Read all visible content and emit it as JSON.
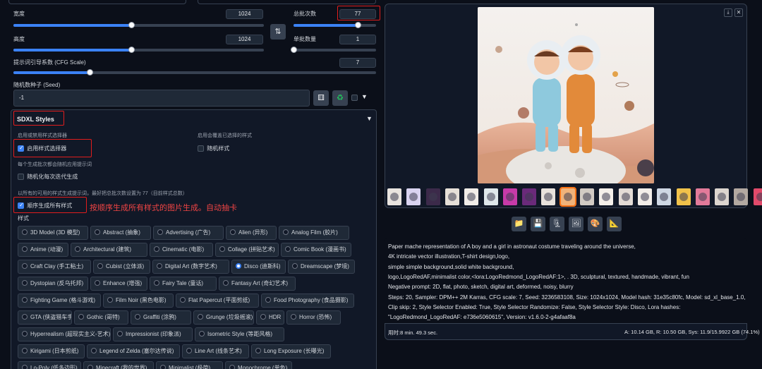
{
  "left": {
    "width": {
      "label": "宽度",
      "value": "1024",
      "fraction": 0.47
    },
    "height": {
      "label": "高度",
      "value": "1024",
      "fraction": 0.47
    },
    "swap_icon": "swap-arrows-icon",
    "batch_count": {
      "label": "总批次数",
      "value": "77",
      "fraction": 0.78
    },
    "batch_size": {
      "label": "单批数量",
      "value": "1",
      "fraction": 0.0
    },
    "cfg": {
      "label": "提示词引导系数 (CFG Scale)",
      "value": "7",
      "fraction": 0.21
    },
    "seed": {
      "label": "随机数种子 (Seed)",
      "value": "-1"
    },
    "seed_icons": [
      "dice-icon",
      "recycle-icon"
    ]
  },
  "sdxl": {
    "title": "SDXL Styles",
    "enable_hint": "启用或禁用样式选择器",
    "enable_label": "启用样式选择器",
    "random_hint": "启用会覆盖已选择的样式",
    "random_label": "随机样式",
    "each_batch_hint": "每个生成批次都会随机应用提示词",
    "randomize_each_label": "随机化每次迭代生成",
    "all_styles_hint": "以所有的可用的样式生成提示词，最好把总批次数设置为 77（目前样式总数）",
    "all_styles_label": "顺序生成所有样式",
    "annotation": "按顺序生成所有样式的图片生成。自动抽卡",
    "styles_label": "样式",
    "styles": [
      [
        "3D Model (3D 模型)",
        "Abstract (抽象)",
        "Advertising (广告)",
        "Alien (异形)",
        "Analog Film (胶片)"
      ],
      [
        "Anime (动漫)",
        "Architectural (建筑)",
        "Cinematic (电影)",
        "Collage (拼贴艺术)",
        "Comic Book (漫画书)"
      ],
      [
        "Craft Clay (手工粘土)",
        "Cubist (立体派)",
        "Digital Art (数字艺术)",
        "Disco (迪斯科)",
        "Dreamscape (梦境)"
      ],
      [
        "Dystopian (反乌托邦)",
        "Enhance (增强)",
        "Fairy Tale (童话)",
        "Fantasy Art (奇幻艺术)"
      ],
      [
        "Fighting Game (格斗游戏)",
        "Film Noir (黑色电影)",
        "Flat Papercut (平面剪纸)",
        "Food Photography (食品摄影)"
      ],
      [
        "GTA (侠盗猎车手)",
        "Gothic (哥特)",
        "Graffiti (涂鸦)",
        "Grunge (垃圾摇滚)",
        "HDR",
        "Horror (恐怖)"
      ],
      [
        "Hyperrealism (超现实主义-艺术)",
        "Impressionist (印象派)",
        "Isometric Style (等距风格)"
      ],
      [
        "Kirigami (日本剪纸)",
        "Legend of Zelda (塞尔达传说)",
        "Line Art (线条艺术)",
        "Long Exposure (长曝光)"
      ],
      [
        "Lo-Poly (低多边形)",
        "Minecraft (我的世界)",
        "Minimalist (极简)",
        "Monochrome (单色)"
      ]
    ],
    "selected": "Disco (迪斯科)"
  },
  "right": {
    "top_icons": [
      "download-icon",
      "close-icon"
    ],
    "toolbar_icons": [
      "folder-icon",
      "save-icon",
      "zip-icon",
      "image-icon",
      "palette-icon",
      "ruler-icon"
    ],
    "info_lines": [
      "Paper mache representation of A boy and a girl in astronaut costume traveling around the universe,",
      "4K intricate vector illustration,T-shirt design,logo,",
      "simple simple background,solid white background,",
      "logo,LogoRedAF,minimalist color,<lora:LogoRedmond_LogoRedAF:1>, . 3D, sculptural, textured, handmade, vibrant, fun",
      "Negative prompt: 2D, flat, photo, sketch, digital art, deformed, noisy, blurry",
      "Steps: 20, Sampler: DPM++ 2M Karras, CFG scale: 7, Seed: 3236583108, Size: 1024x1024, Model hash: 31e35c80fc, Model: sd_xl_base_1.0,",
      "Clip skip: 2, Style Selector Enabled: True, Style Selector Randomize: False, Style Selector Style: Disco, Lora hashes:",
      "\"LogoRedmond_LogoRedAF: e736e5060615\", Version: v1.6.0-2-g4afaaf8a"
    ],
    "time": "用时:8 min. 49.3 sec.",
    "mem": "A: 10.14 GB, R: 10.50 GB, Sys: 11.9/15.9922 GB (74.1%)"
  }
}
